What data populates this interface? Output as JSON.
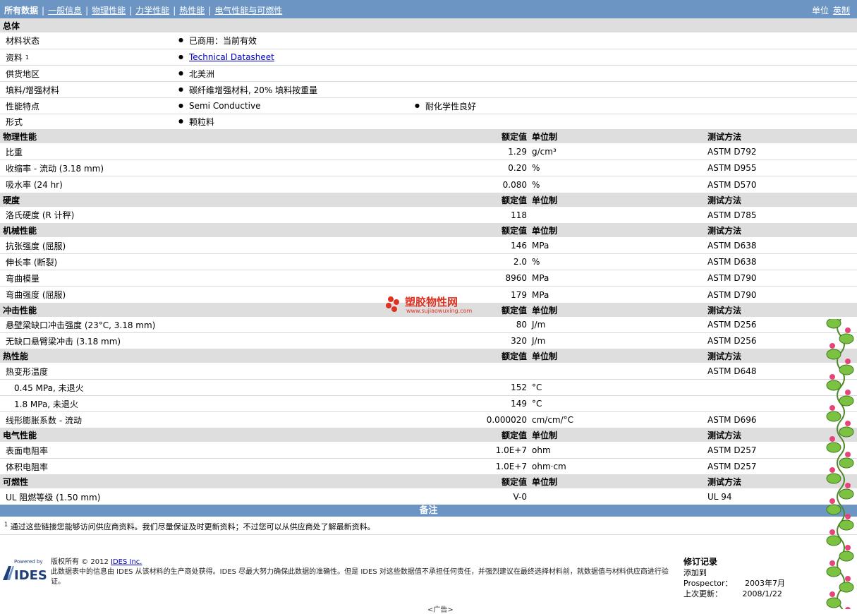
{
  "nav": {
    "current": "所有数据",
    "links": [
      "一般信息",
      "物理性能",
      "力学性能",
      "热性能",
      "电气性能与可燃性"
    ],
    "units_label": "单位",
    "units_value": "英制"
  },
  "general": {
    "title": "总体",
    "rows": [
      {
        "name": "材料状态",
        "v1": "已商用：当前有效"
      },
      {
        "name": "资料",
        "sup": "1",
        "link": "Technical Datasheet"
      },
      {
        "name": "供货地区",
        "v1": "北美洲"
      },
      {
        "name": "填料/增强材料",
        "v1": "碳纤维增强材料, 20% 填料按重量"
      },
      {
        "name": "性能特点",
        "v1": "Semi Conductive",
        "v2": "耐化学性良好"
      },
      {
        "name": "形式",
        "v1": "颗粒料"
      }
    ]
  },
  "headers": {
    "value": "额定值",
    "unit": "单位制",
    "method": "测试方法"
  },
  "physical": {
    "title": "物理性能",
    "rows": [
      {
        "name": "比重",
        "value": "1.29",
        "unit": "g/cm³",
        "method": "ASTM D792"
      },
      {
        "name": "收缩率 - 流动  (3.18 mm)",
        "value": "0.20",
        "unit": "%",
        "method": "ASTM D955"
      },
      {
        "name": "吸水率  (24 hr)",
        "value": "0.080",
        "unit": "%",
        "method": "ASTM D570"
      }
    ]
  },
  "hardness": {
    "title": "硬度",
    "rows": [
      {
        "name": "洛氏硬度  (R 计秤)",
        "value": "118",
        "unit": "",
        "method": "ASTM D785"
      }
    ]
  },
  "mechanical": {
    "title": "机械性能",
    "rows": [
      {
        "name": "抗张强度  (屈服)",
        "value": "146",
        "unit": "MPa",
        "method": "ASTM D638"
      },
      {
        "name": "伸长率  (断裂)",
        "value": "2.0",
        "unit": "%",
        "method": "ASTM D638"
      },
      {
        "name": "弯曲模量",
        "value": "8960",
        "unit": "MPa",
        "method": "ASTM D790"
      },
      {
        "name": "弯曲强度  (屈服)",
        "value": "179",
        "unit": "MPa",
        "method": "ASTM D790"
      }
    ]
  },
  "impact": {
    "title": "冲击性能",
    "rows": [
      {
        "name": "悬壁梁缺口冲击强度  (23°C, 3.18 mm)",
        "value": "80",
        "unit": "J/m",
        "method": "ASTM D256"
      },
      {
        "name": "无缺口悬臂梁冲击  (3.18 mm)",
        "value": "320",
        "unit": "J/m",
        "method": "ASTM D256"
      }
    ]
  },
  "thermal": {
    "title": "热性能",
    "rows": [
      {
        "name": "热变形温度",
        "value": "",
        "unit": "",
        "method": "ASTM D648"
      },
      {
        "name": "0.45 MPa, 未退火",
        "value": "152",
        "unit": "°C",
        "method": ""
      },
      {
        "name": "1.8 MPa, 未退火",
        "value": "149",
        "unit": "°C",
        "method": ""
      },
      {
        "name": "线形膨胀系数 - 流动",
        "value": "0.000020",
        "unit": "cm/cm/°C",
        "method": "ASTM D696"
      }
    ]
  },
  "electrical": {
    "title": "电气性能",
    "rows": [
      {
        "name": "表面电阻率",
        "value": "1.0E+7",
        "unit": "ohm",
        "method": "ASTM D257"
      },
      {
        "name": "体积电阻率",
        "value": "1.0E+7",
        "unit": "ohm·cm",
        "method": "ASTM D257"
      }
    ]
  },
  "flammability": {
    "title": "可燃性",
    "rows": [
      {
        "name": "UL 阻燃等级  (1.50 mm)",
        "value": "V-0",
        "unit": "",
        "method": "UL 94"
      }
    ]
  },
  "notes": {
    "title": "备注",
    "sup": "1",
    "text": "通过这些链接您能够访问供应商资料。我们尽量保证及时更新资料；不过您可以从供应商处了解最新资料。"
  },
  "footer": {
    "logo_powered": "Powered by",
    "logo_name": "IDES",
    "copyright": "版权所有  © 2012",
    "company_link": "IDES Inc.",
    "disclaimer": "此数据表中的信息由 IDES 从该材料的生产商处获得。IDES 尽最大努力确保此数据的准确性。但是 IDES 对这些数据值不承担任何责任，并强烈建议在最终选择材料前，就数据值与材料供应商进行验证。",
    "revision": {
      "title": "修订记录",
      "added_label": "添加到 Prospector：",
      "added_value": "2003年7月",
      "updated_label": "上次更新：",
      "updated_value": "2008/1/22"
    },
    "ad": "<广告>"
  },
  "watermark": {
    "text": "塑胶物性网",
    "url": "www.sujiaowuxing.com"
  },
  "colors": {
    "bar": "#6c95c4",
    "section": "#dedede",
    "watermark": "#e03020"
  }
}
